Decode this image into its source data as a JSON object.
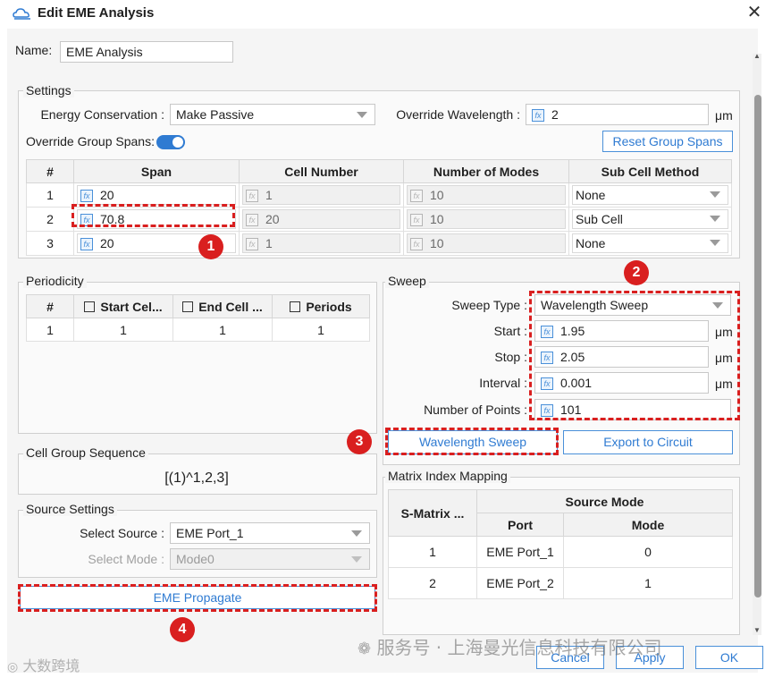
{
  "window": {
    "title": "Edit EME Analysis"
  },
  "name": {
    "label": "Name:",
    "value": "EME Analysis"
  },
  "settings": {
    "title": "Settings",
    "energy_label": "Energy Conservation :",
    "energy_value": "Make Passive",
    "override_wl_label": "Override Wavelength :",
    "override_wl_value": "2",
    "override_wl_unit": "μm",
    "override_spans_label": "Override Group Spans:",
    "reset_button": "Reset Group Spans",
    "columns": [
      "#",
      "Span",
      "Cell Number",
      "Number of Modes",
      "Sub Cell Method"
    ],
    "rows": [
      {
        "idx": "1",
        "span": "20",
        "cells": "1",
        "modes": "10",
        "method": "None"
      },
      {
        "idx": "2",
        "span": "70.8",
        "cells": "20",
        "modes": "10",
        "method": "Sub Cell"
      },
      {
        "idx": "3",
        "span": "20",
        "cells": "1",
        "modes": "10",
        "method": "None"
      }
    ]
  },
  "periodicity": {
    "title": "Periodicity",
    "columns": [
      "#",
      "Start Cel...",
      "End Cell ...",
      "Periods"
    ],
    "rows": [
      {
        "idx": "1",
        "start": "1",
        "end": "1",
        "periods": "1"
      }
    ]
  },
  "sweep": {
    "title": "Sweep",
    "type_label": "Sweep Type :",
    "type_value": "Wavelength Sweep",
    "start_label": "Start :",
    "start_value": "1.95",
    "stop_label": "Stop :",
    "stop_value": "2.05",
    "interval_label": "Interval :",
    "interval_value": "0.001",
    "points_label": "Number of Points :",
    "points_value": "101",
    "unit": "μm",
    "wl_sweep_button": "Wavelength Sweep",
    "export_button": "Export to Circuit"
  },
  "cell_group": {
    "title": "Cell Group Sequence",
    "value": "[(1)^1,2,3]"
  },
  "source": {
    "title": "Source Settings",
    "select_source_label": "Select Source :",
    "select_source_value": "EME Port_1",
    "select_mode_label": "Select Mode :",
    "select_mode_value": "Mode0"
  },
  "propagate_button": "EME Propagate",
  "matrix": {
    "title": "Matrix Index Mapping",
    "col_smatrix": "S-Matrix ...",
    "col_source_mode": "Source Mode",
    "col_port": "Port",
    "col_mode": "Mode",
    "rows": [
      {
        "idx": "1",
        "port": "EME Port_1",
        "mode": "0"
      },
      {
        "idx": "2",
        "port": "EME Port_2",
        "mode": "1"
      }
    ]
  },
  "footer": {
    "cancel": "Cancel",
    "apply": "Apply",
    "ok": "OK"
  },
  "watermark": {
    "left": "大数跨境",
    "right": "服务号 · 上海曼光信息科技有限公司"
  },
  "badges": [
    "1",
    "2",
    "3",
    "4"
  ],
  "colors": {
    "accent": "#2f7bd2",
    "annotation": "#d91f1f"
  }
}
